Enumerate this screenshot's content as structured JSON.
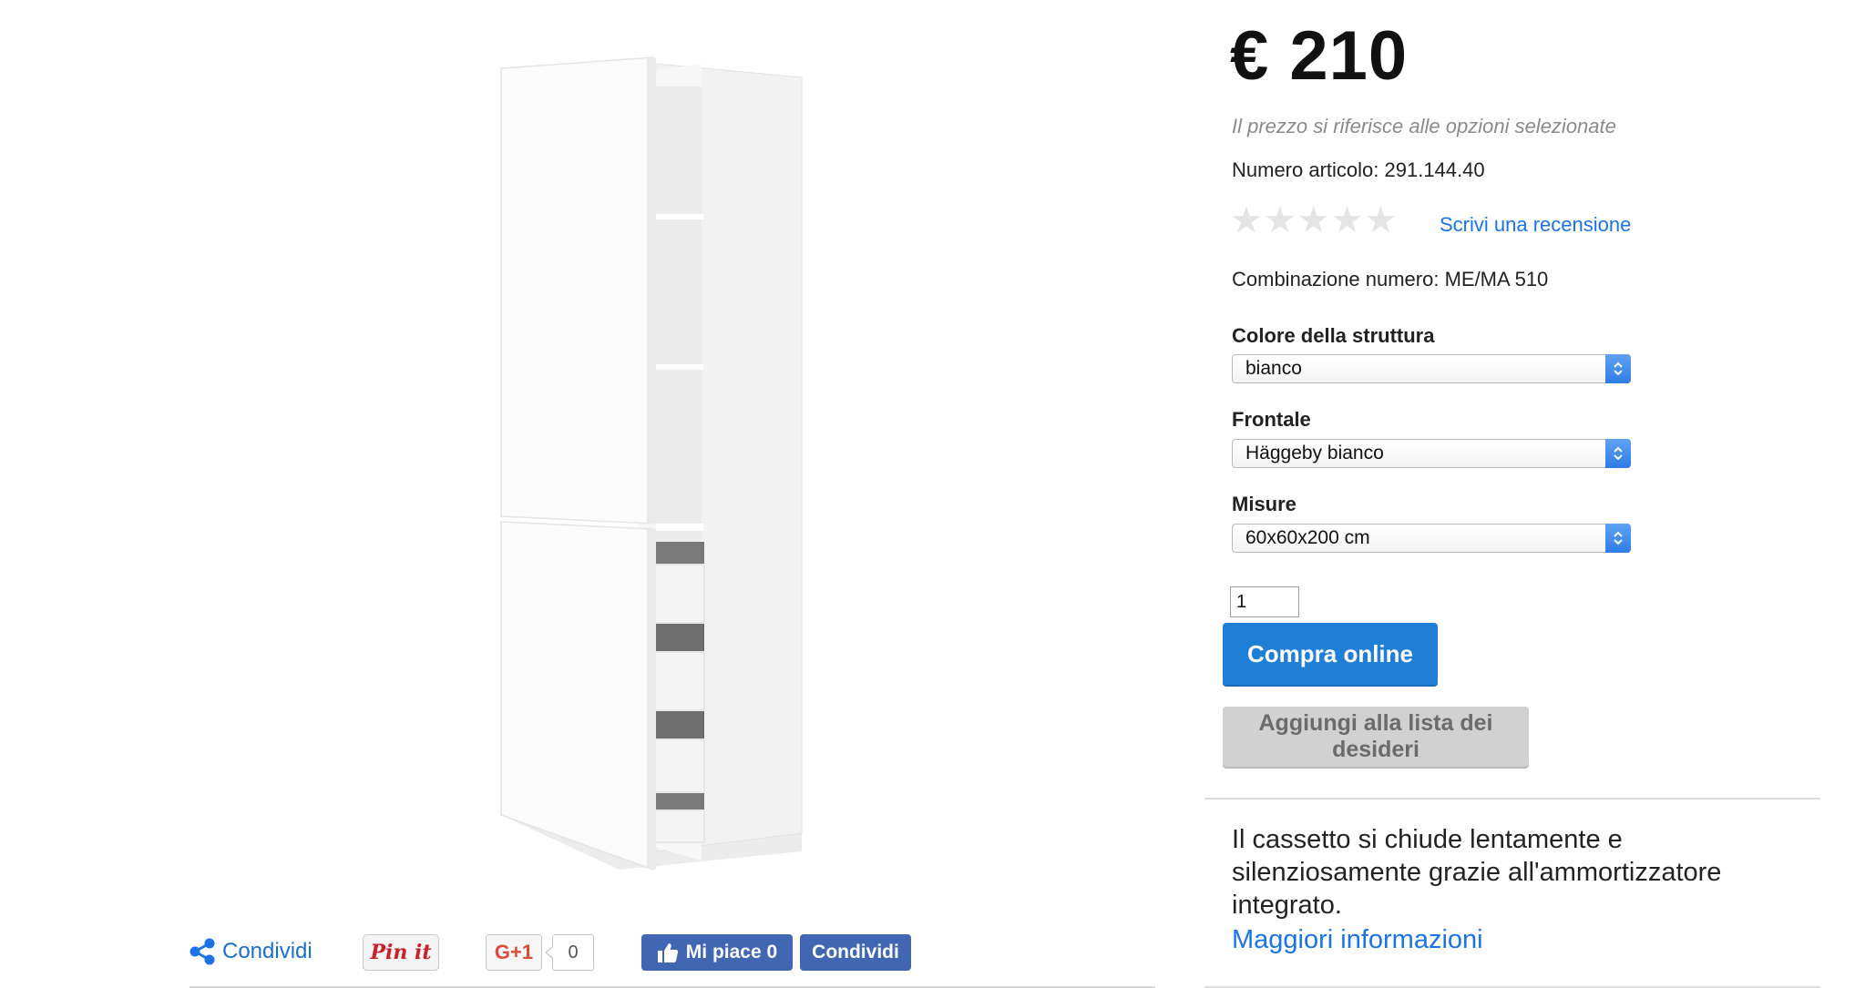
{
  "product": {
    "price": "€ 210",
    "price_note": "Il prezzo si riferisce alle opzioni selezionate",
    "article_number": "Numero articolo: 291.144.40",
    "rating": {
      "value": 0,
      "max": 5,
      "star_color": "#e4e4e4"
    },
    "review_link": "Scrivi una recensione",
    "combination": "Combinazione numero: ME/MA 510"
  },
  "options": [
    {
      "label": "Colore della struttura",
      "value": "bianco"
    },
    {
      "label": "Frontale",
      "value": "Häggeby bianco"
    },
    {
      "label": "Misure",
      "value": "60x60x200 cm"
    }
  ],
  "quantity": "1",
  "actions": {
    "buy_label": "Compra online",
    "wishlist_label": "Aggiungi alla lista dei desideri"
  },
  "feature": {
    "text": "Il cassetto si chiude lentamente e silenziosamente grazie all'ammortizzatore integrato.",
    "more_link": "Maggiori informazioni"
  },
  "share": {
    "share_label": "Condividi",
    "pinterest_label": "Pin it",
    "gplus_label": "G+1",
    "gplus_count": "0",
    "fb_like_label": "Mi piace",
    "fb_like_count": "0",
    "fb_share_label": "Condividi"
  },
  "colors": {
    "link": "#1a73e8",
    "buy_button": "#1f7fd6",
    "wishlist_button": "#d1d1d1",
    "facebook": "#4267b2",
    "pinterest": "#cb2027",
    "gplus": "#dd4b39"
  },
  "icons": {
    "share": "share-icon",
    "thumbs_up": "thumbs-up-icon",
    "select_arrows": "updown-arrows-icon",
    "star": "star-icon"
  }
}
